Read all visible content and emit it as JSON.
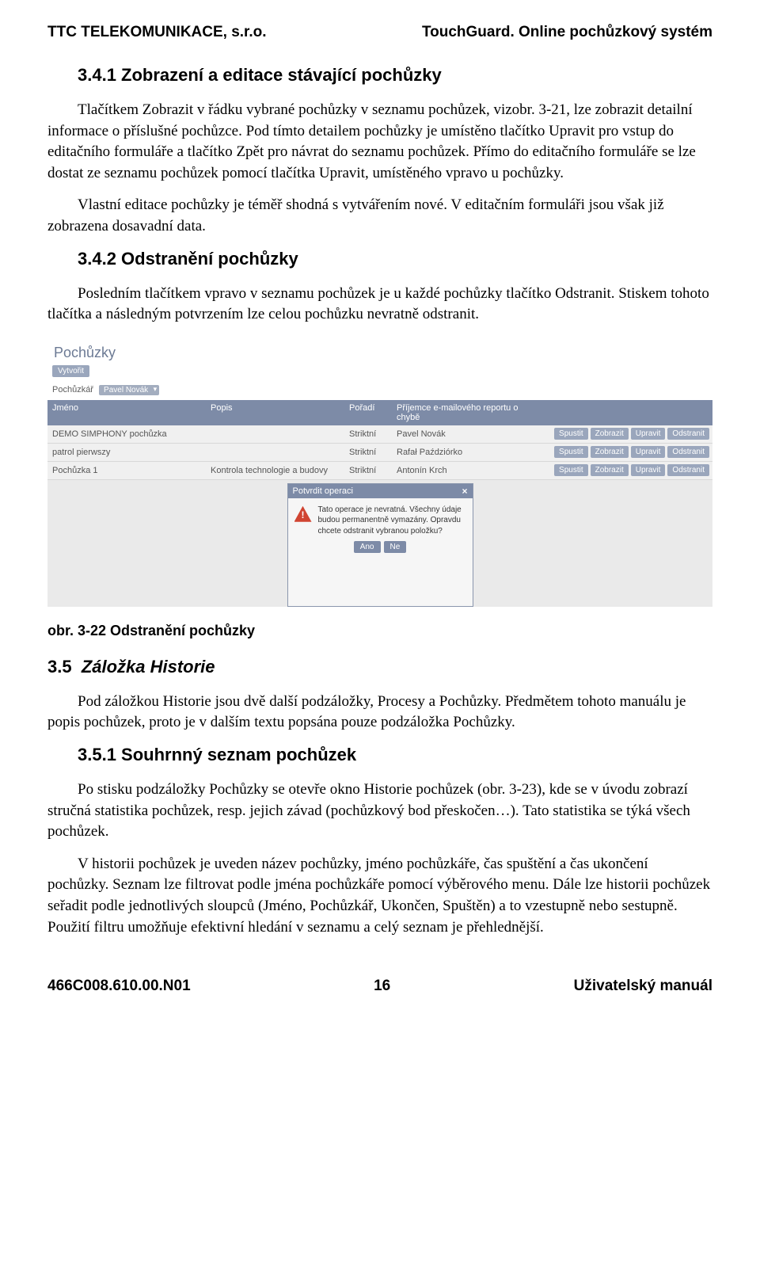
{
  "header": {
    "company": "TTC TELEKOMUNIKACE, s.r.o.",
    "product": "TouchGuard. Online pochůzkový systém"
  },
  "section_3_4_1": {
    "heading": "3.4.1 Zobrazení a editace stávající pochůzky",
    "p1": "Tlačítkem Zobrazit v řádku vybrané pochůzky v seznamu pochůzek, vizobr. 3-21, lze zobrazit detailní informace o příslušné pochůzce. Pod tímto detailem pochůzky je umístěno tlačítko Upravit pro vstup do editačního formuláře a tlačítko Zpět pro návrat do seznamu pochůzek. Přímo do editačního formuláře se lze dostat ze seznamu pochůzek pomocí tlačítka Upravit, umístěného vpravo u pochůzky.",
    "p2": "Vlastní editace pochůzky je téměř shodná s vytvářením nové. V editačním formuláři jsou však již zobrazena dosavadní data."
  },
  "section_3_4_2": {
    "heading": "3.4.2 Odstranění pochůzky",
    "p1": "Posledním tlačítkem vpravo v seznamu pochůzek je u každé pochůzky tlačítko Odstranit. Stiskem tohoto tlačítka a následným potvrzením lze celou pochůzku nevratně odstranit."
  },
  "screenshot": {
    "title": "Pochůzky",
    "create": "Vytvořit",
    "filter_label": "Pochůzkář",
    "filter_value": "Pavel Novák",
    "columns": {
      "c1": "Jméno",
      "c2": "Popis",
      "c3": "Pořadí",
      "c4": "Příjemce e-mailového reportu o chybě"
    },
    "rows": [
      {
        "name": "DEMO SIMPHONY pochůzka",
        "popis": "",
        "poradi": "Striktní",
        "prijemce": "Pavel Novák"
      },
      {
        "name": "patrol pierwszy",
        "popis": "",
        "poradi": "Striktní",
        "prijemce": "Rafał Paździórko"
      },
      {
        "name": "Pochůzka 1",
        "popis": "Kontrola technologie a budovy",
        "poradi": "Striktní",
        "prijemce": "Antonín Krch"
      }
    ],
    "row_buttons": {
      "b1": "Spustit",
      "b2": "Zobrazit",
      "b3": "Upravit",
      "b4": "Odstranit"
    },
    "dialog": {
      "title": "Potvrdit operaci",
      "text": "Tato operace je nevratná. Všechny údaje budou permanentně vymazány. Opravdu chcete odstranit vybranou položku?",
      "yes": "Ano",
      "no": "Ne"
    }
  },
  "fig_caption": "obr. 3-22 Odstranění pochůzky",
  "section_3_5": {
    "heading": "3.5  Záložka Historie",
    "p1": "Pod záložkou Historie jsou dvě další podzáložky, Procesy a Pochůzky. Předmětem tohoto manuálu je popis pochůzek, proto je v dalším textu popsána pouze podzáložka Pochůzky."
  },
  "section_3_5_1": {
    "heading": "3.5.1 Souhrnný seznam pochůzek",
    "p1": "Po stisku podzáložky Pochůzky se otevře okno Historie pochůzek (obr. 3-23), kde se v úvodu zobrazí stručná statistika pochůzek, resp. jejich závad (pochůzkový bod přeskočen…). Tato statistika se týká všech pochůzek.",
    "p2": "V historii pochůzek je uveden název pochůzky, jméno pochůzkáře, čas spuštění a čas ukončení pochůzky. Seznam lze filtrovat podle jména pochůzkáře pomocí výběrového menu. Dále lze historii pochůzek seřadit podle jednotlivých sloupců (Jméno, Pochůzkář, Ukončen, Spuštěn) a to vzestupně nebo sestupně. Použití filtru umožňuje efektivní hledání v seznamu a celý seznam je přehlednější."
  },
  "footer": {
    "doc_id": "466C008.610.00.N01",
    "page": "16",
    "doc_type": "Uživatelský manuál"
  }
}
